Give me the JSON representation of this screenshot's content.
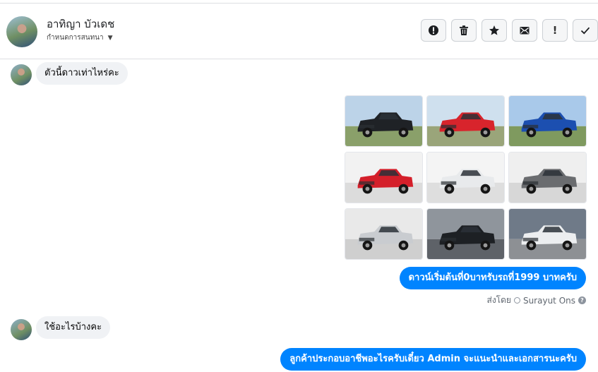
{
  "header": {
    "contact_name": "อาทิญา บัวเดช",
    "conversation_setting": "กำหนดการสนทนา",
    "actions": [
      {
        "name": "report-button",
        "icon": "alert-circle-icon"
      },
      {
        "name": "delete-button",
        "icon": "trash-icon"
      },
      {
        "name": "star-button",
        "icon": "star-icon"
      },
      {
        "name": "mark-unread-button",
        "icon": "envelope-icon"
      },
      {
        "name": "mark-spam-button",
        "label": "!"
      },
      {
        "name": "mark-done-button",
        "icon": "checkmark-icon"
      }
    ]
  },
  "messages": {
    "incoming_1": "ตัวนี้ดาวเท่าไหร่คะ",
    "outgoing_1": "ดาวน์เริ่มต้นที่0บาทรับรถที่1999 บาทครับ",
    "sent_by_prefix": "ส่งโดย",
    "sent_by_name": "Surayut Ons",
    "incoming_2": "ใช้อะไรบ้างคะ",
    "outgoing_2": "ลูกค้าประกอบอาชีพอะไรครับเดี๋ยว Admin จะแนะนำและเอกสารนะครับ"
  },
  "photos": [
    {
      "color": "#1f2226",
      "sky": "#bcd3e8",
      "ground": "#8aa06a"
    },
    {
      "color": "#d8242c",
      "sky": "#cfe0ee",
      "ground": "#9aa57a"
    },
    {
      "color": "#1c4fb0",
      "sky": "#a9c9ea",
      "ground": "#7f9a5f"
    },
    {
      "color": "#d41f2a",
      "sky": "#f2f2f2",
      "ground": "#dcdcdc"
    },
    {
      "color": "#e8eaec",
      "sky": "#f4f4f4",
      "ground": "#dedede"
    },
    {
      "color": "#6a6c6f",
      "sky": "#efefef",
      "ground": "#d7d7d7"
    },
    {
      "color": "#c9ccd0",
      "sky": "#e9e9e9",
      "ground": "#cfcfcf"
    },
    {
      "color": "#1d2024",
      "sky": "#8f959c",
      "ground": "#5e6268"
    },
    {
      "color": "#eceef0",
      "sky": "#6f7a88",
      "ground": "#8d9094"
    }
  ],
  "colors": {
    "accent": "#0084ff",
    "incoming_bubble": "#f0f2f5"
  }
}
